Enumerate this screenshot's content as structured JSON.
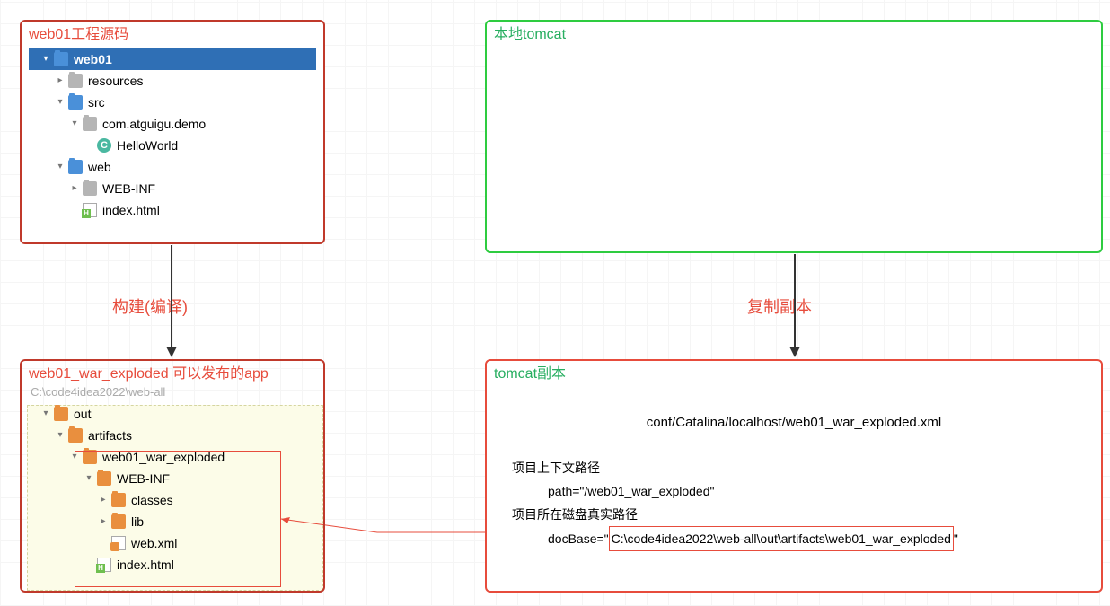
{
  "source": {
    "title": "web01工程源码",
    "tree": {
      "root": "web01",
      "items": {
        "resources": "resources",
        "src": "src",
        "package": "com.atguigu.demo",
        "class": "HelloWorld",
        "web": "web",
        "webinf": "WEB-INF",
        "index": "index.html"
      }
    }
  },
  "tomcat": {
    "title": "本地tomcat"
  },
  "build_label": "构建(编译)",
  "copy_label": "复制副本",
  "exploded": {
    "title": "web01_war_exploded 可以发布的app",
    "path": "C:\\code4idea2022\\web-all",
    "tree": {
      "out": "out",
      "artifacts": "artifacts",
      "root": "web01_war_exploded",
      "webinf": "WEB-INF",
      "classes": "classes",
      "lib": "lib",
      "webxml": "web.xml",
      "index": "index.html"
    }
  },
  "copy": {
    "title": "tomcat副本",
    "conf_path": "conf/Catalina/localhost/web01_war_exploded.xml",
    "context_label": "项目上下文路径",
    "path_kv": "path=\"/web01_war_exploded\"",
    "disk_label": "项目所在磁盘真实路径",
    "docbase_prefix": "docBase=\"",
    "docbase_value": "C:\\code4idea2022\\web-all\\out\\artifacts\\web01_war_exploded",
    "docbase_suffix": "\""
  }
}
